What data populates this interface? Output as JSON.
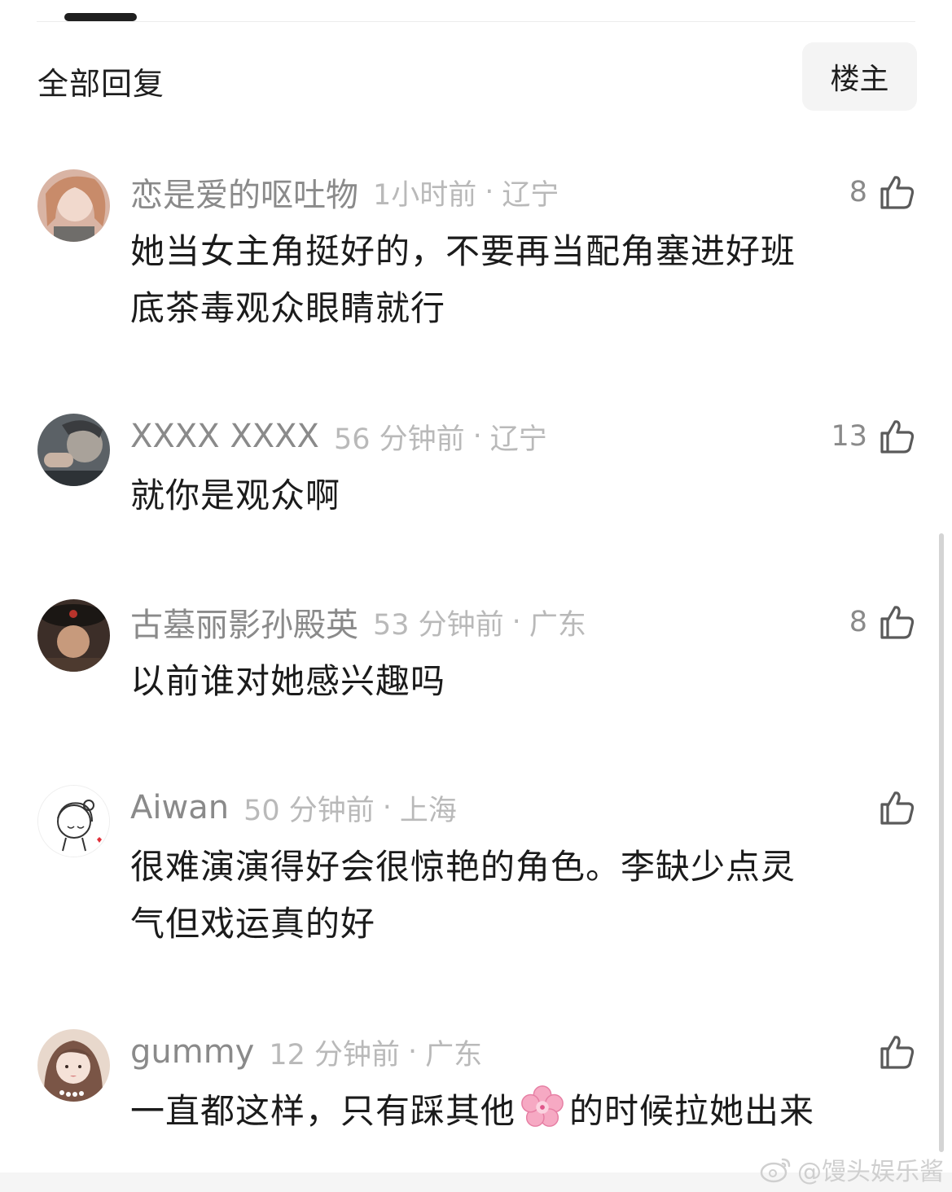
{
  "header": {
    "title": "全部回复",
    "op_button": "楼主"
  },
  "comments": [
    {
      "username": "恋是爱的呕吐物",
      "time": "1小时前",
      "separator": "·",
      "location": "辽宁",
      "likes": "8",
      "lines": [
        "她当女主角挺好的，不要再当配角塞进好班",
        "底茶毒观众眼睛就行"
      ]
    },
    {
      "username": "XXXX XXXX",
      "time": "56 分钟前",
      "separator": "·",
      "location": "辽宁",
      "likes": "13",
      "lines": [
        "就你是观众啊"
      ]
    },
    {
      "username": "古墓丽影孙殿英",
      "time": "53 分钟前",
      "separator": "·",
      "location": "广东",
      "likes": "8",
      "lines": [
        "以前谁对她感兴趣吗"
      ]
    },
    {
      "username": "Aiwan",
      "time": "50 分钟前",
      "separator": "·",
      "location": "上海",
      "likes": "",
      "lines": [
        "很难演演得好会很惊艳的角色。李缺少点灵",
        "气但戏运真的好"
      ]
    },
    {
      "username": "gummy",
      "time": "12 分钟前",
      "separator": "·",
      "location": "广东",
      "likes": "",
      "line_before_icon": "一直都这样，只有踩其他",
      "inline_icon": "cherry-blossom-icon",
      "line_after_icon": "的时候拉她出来"
    }
  ],
  "watermark": "@馒头娱乐酱"
}
